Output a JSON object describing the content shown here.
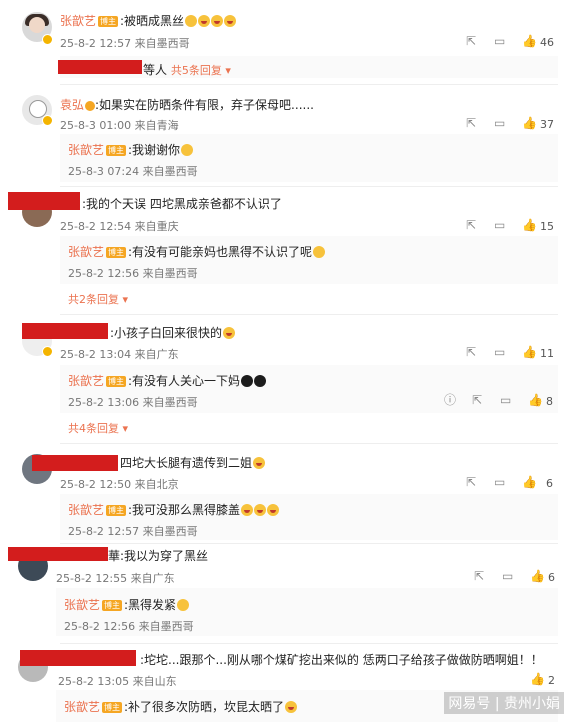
{
  "comments": [
    {
      "user": "张歆艺",
      "badge": "博主",
      "text": ":被晒成黑丝",
      "time": "25-8-2 12:57 来自墨西哥",
      "likes": "46",
      "more_prefix": "等人",
      "more": "共5条回复"
    },
    {
      "user": "袁弘",
      "text": ":如果实在防晒条件有限，弃子保母吧......",
      "time": "25-8-3 01:00 来自青海",
      "likes": "37",
      "reply": {
        "user": "张歆艺",
        "badge": "博主",
        "text": ":我谢谢你",
        "time": "25-8-3 07:24 来自墨西哥"
      }
    },
    {
      "text": ":我的个天误 四坨黑成亲爸都不认识了",
      "time": "25-8-2 12:54 来自重庆",
      "likes": "15",
      "reply": {
        "user": "张歆艺",
        "badge": "博主",
        "text": ":有没有可能亲妈也黑得不认识了呢",
        "time": "25-8-2 12:56 来自墨西哥"
      },
      "more": "共2条回复"
    },
    {
      "text": ":小孩子白回来很快的",
      "time": "25-8-2 13:04 来自广东",
      "likes": "11",
      "reply": {
        "user": "张歆艺",
        "badge": "博主",
        "text": ":有没有人关心一下妈",
        "time": "25-8-2 13:06 来自墨西哥",
        "likes": "8"
      },
      "more": "共4条回复"
    },
    {
      "text": "四坨大长腿有遗传到二姐",
      "time": "25-8-2 12:50 来自北京",
      "likes": "6",
      "reply": {
        "user": "张歆艺",
        "badge": "博主",
        "text": ":我可没那么黑得膝盖",
        "time": "25-8-2 12:57 来自墨西哥"
      }
    },
    {
      "text": "華:我以为穿了黑丝",
      "time": "25-8-2 12:55 来自广东",
      "likes": "6",
      "reply": {
        "user": "张歆艺",
        "badge": "博主",
        "text": ":黑得发紧",
        "time": "25-8-2 12:56 来自墨西哥"
      }
    },
    {
      "text": ":坨坨...跟那个...刚从哪个煤矿挖出来似的 恁两口子给孩子做做防晒啊姐！！",
      "time": "25-8-2 13:05 来自山东",
      "likes": "2",
      "reply": {
        "user": "张歆艺",
        "badge": "博主",
        "text": ":补了很多次防晒，坎昆太晒了"
      }
    }
  ],
  "watermark": "网易号 | 贵州小娟",
  "colors": {
    "username": "#eb7350",
    "badge": "#f5a623",
    "redaction": "#d31d1d"
  }
}
